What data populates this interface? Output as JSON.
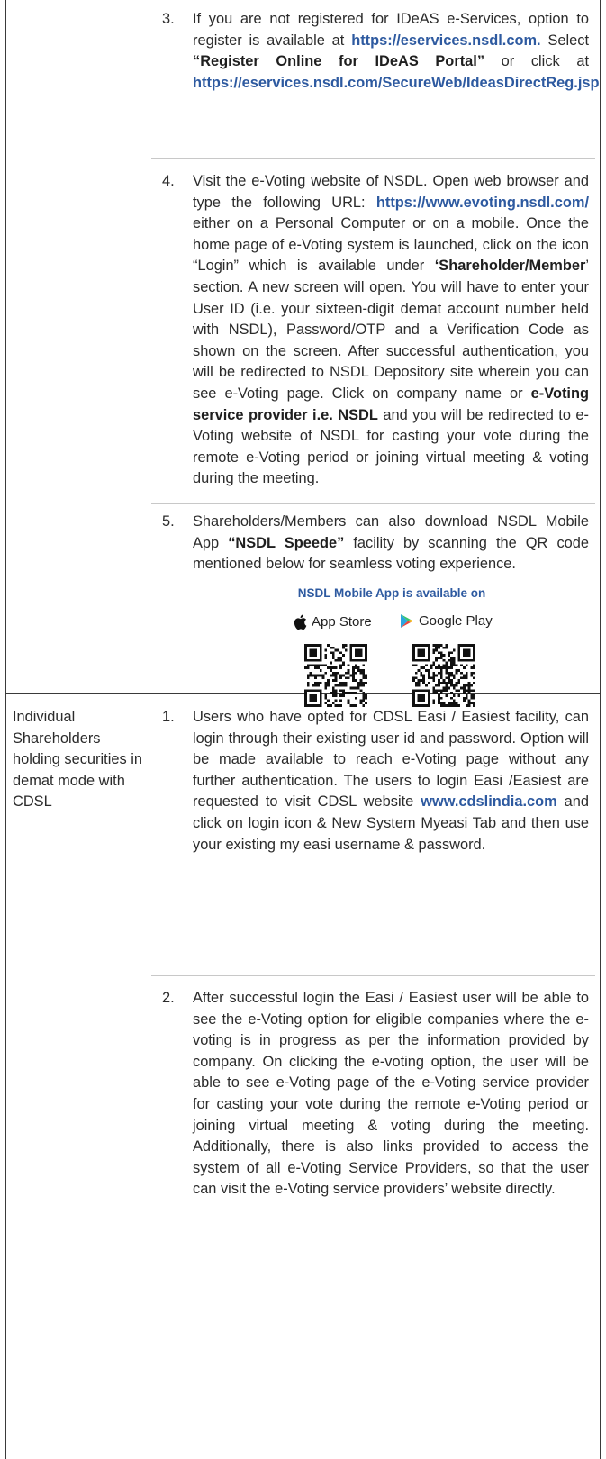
{
  "row1": {
    "items": [
      {
        "num": "3.",
        "parts": [
          {
            "t": "If you are not registered for IDeAS e-Services, option to register is available at "
          },
          {
            "t": "https://eservices.nsdl.com.",
            "c": "link"
          },
          {
            "t": " Select "
          },
          {
            "t": "“Register Online for IDeAS Portal”",
            "c": "b"
          },
          {
            "t": " or click at "
          },
          {
            "t": "https://eservices.nsdl.com/SecureWeb/IdeasDirectReg.jsp",
            "c": "link"
          }
        ]
      },
      {
        "num": "4.",
        "parts": [
          {
            "t": "Visit the e-Voting website of NSDL. Open web browser and type the following URL: "
          },
          {
            "t": "https://www.evoting.nsdl.com/",
            "c": "link"
          },
          {
            "t": " either on a Personal Computer or on a mobile. Once the home page of e-Voting system is launched, click on the icon “Login” which is available under "
          },
          {
            "t": "‘Shareholder/Member",
            "c": "b"
          },
          {
            "t": "’ section. A new screen will open. You will have to enter your User ID (i.e. your sixteen-digit demat account number held with NSDL), Password/OTP and a Verification Code as shown on the screen. After successful authentication, you will be redirected to NSDL Depository site wherein you can see e-Voting page. Click on company name or "
          },
          {
            "t": "e-Voting service provider i.e. NSDL",
            "c": "b"
          },
          {
            "t": " and you will be redirected to e-Voting website of NSDL for casting your vote during the remote e-Voting period or joining virtual meeting & voting during the meeting."
          }
        ]
      },
      {
        "num": "5.",
        "parts": [
          {
            "t": "Shareholders/Members can also download NSDL Mobile App "
          },
          {
            "t": "“NSDL Speede”",
            "c": "b"
          },
          {
            "t": " facility by scanning the QR code mentioned below for seamless voting experience."
          }
        ]
      }
    ],
    "app_box": {
      "title": "NSDL Mobile App is available on",
      "app_store": "App Store",
      "google_play": "Google Play"
    }
  },
  "row2": {
    "left_label": "Individual Shareholders holding securities in demat mode with CDSL",
    "items": [
      {
        "num": "1.",
        "parts": [
          {
            "t": "Users who have opted for CDSL Easi / Easiest facility, can login through their existing user id and password. Option will be made available to reach e-Voting page without any further authentication. The users to login Easi /Easiest are requested to visit CDSL website "
          },
          {
            "t": "www.cdslindia.com",
            "c": "link"
          },
          {
            "t": " and click on login icon & New System Myeasi Tab and then use your existing my easi username & password."
          }
        ]
      },
      {
        "num": "2.",
        "parts": [
          {
            "t": "After successful login the Easi / Easiest user will be able to see the e-Voting option for eligible companies where the e-voting is in progress as per the information provided by company. On clicking the e-voting option, the user will be able to see e-Voting page of the e-Voting service provider for casting your vote during the remote e-Voting period or joining virtual meeting & voting during the meeting. Additionally, there is also links provided to access the system of all e-Voting Service Providers, so that the user can visit the e-Voting service providers’ website directly."
          }
        ]
      }
    ]
  },
  "colors": {
    "link": "#2e5aa0",
    "border": "#3a3a3a",
    "text": "#2b2b2b"
  },
  "icons": [
    "apple-icon",
    "google-play-icon",
    "qr-code-icon"
  ]
}
